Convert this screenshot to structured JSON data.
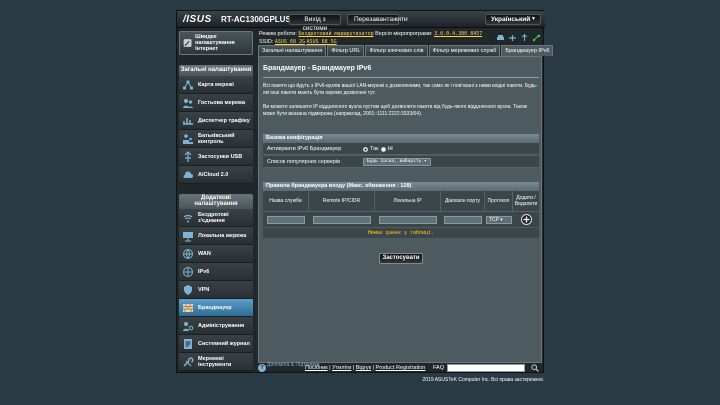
{
  "header": {
    "brand": "/ISUS",
    "model": "RT-AC1300GPLUS",
    "logout_label": "Вихід з системи",
    "reboot_label": "Перезавантажити",
    "language": "Український"
  },
  "info": {
    "mode_label": "Режим роботи:",
    "mode_value": "Бездротовий маршрутизатор",
    "firmware_label": "Версія мікропрограми:",
    "firmware_value": "3.0.0.4.380_8457",
    "ssid_label": "SSID:",
    "ssid_1": "ASUS_68_2G",
    "ssid_2": "ASUS_68_5G"
  },
  "sidebar": {
    "quick_label": "Швидке налаштування Інтернет",
    "general_header": "Загальні налаштування",
    "general_items": [
      {
        "label": "Карта мережі",
        "icon": "network-map-icon"
      },
      {
        "label": "Гостьова мережа",
        "icon": "guest-network-icon"
      },
      {
        "label": "Диспетчер трафіку",
        "icon": "traffic-manager-icon"
      },
      {
        "label": "Батьківський контроль",
        "icon": "parental-control-icon"
      },
      {
        "label": "Застосунки USB",
        "icon": "usb-icon"
      },
      {
        "label": "AiCloud 2.0",
        "icon": "cloud-icon"
      }
    ],
    "advanced_header": "Додаткові налаштування",
    "advanced_items": [
      {
        "label": "Бездротові з'єднання",
        "icon": "wireless-icon"
      },
      {
        "label": "Локальна мережа",
        "icon": "lan-icon"
      },
      {
        "label": "WAN",
        "icon": "wan-icon"
      },
      {
        "label": "IPv6",
        "icon": "ipv6-icon"
      },
      {
        "label": "VPN",
        "icon": "vpn-icon"
      },
      {
        "label": "Брандмауер",
        "icon": "firewall-icon"
      },
      {
        "label": "Адміністрування",
        "icon": "admin-icon"
      },
      {
        "label": "Системний журнал",
        "icon": "log-icon"
      },
      {
        "label": "Мережеві інструменти",
        "icon": "tools-icon"
      }
    ]
  },
  "tabs": [
    "Загальні налаштування",
    "Фільтр URL",
    "Фільтр ключових слів",
    "Фільтр мережевих служб",
    "Брандмауер IPv6"
  ],
  "panel": {
    "title": "Брандмауер - Брандмауер IPv6",
    "desc1": "Всі пакети що йдуть з IPv6-вузлів вашої LAN-мережі є дозволеними, так само як і пов'язані з ними вхідні пакети. Будь-які інші пакети мають бути окремо дозволені тут.",
    "desc2": "Ви можете залишити IP віддаленого вузла пустим щоб дозволити пакети від будь-якого віддаленого вузла. Також може бути вказана підмережа (наприклад, 2001::1111:2222:3333/64).",
    "basic_header": "Базова конфігурація",
    "enable_label": "Активувати IPv6 Брандмауер",
    "yes_label": "Так",
    "no_label": "Ні",
    "services_label": "Список популярних серверів",
    "services_value": "Будь ласка, виберіть",
    "rules_header": "Правила брандмауера входу (Макс. обмеження : 128)",
    "columns": [
      "Назва служби",
      "Remote IP/CIDR",
      "Локальна IP",
      "Діапазон порту",
      "Протокол",
      "Додати / Видалити"
    ],
    "protocol_value": "TCP",
    "empty_text": "Немає даних у таблиці.",
    "apply_label": "Застосувати"
  },
  "footer": {
    "help_text": "Допомога & Підтримка",
    "links": [
      "Посібник",
      "Утиліти",
      "Відгук",
      "Product Registration"
    ],
    "faq": "FAQ",
    "copyright": "2019 ASUSTeK Computer Inc. Всі права застережені."
  }
}
